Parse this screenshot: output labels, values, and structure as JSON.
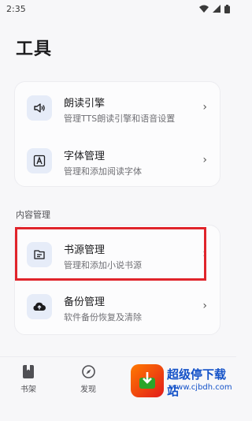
{
  "status_bar": {
    "time": "2:35"
  },
  "page": {
    "title": "工具"
  },
  "group1": {
    "items": [
      {
        "title": "朗读引擎",
        "subtitle": "管理TTS朗读引擎和语音设置",
        "icon": "speaker-icon"
      },
      {
        "title": "字体管理",
        "subtitle": "管理和添加阅读字体",
        "icon": "font-icon"
      }
    ]
  },
  "section": {
    "label": "内容管理"
  },
  "group2": {
    "items": [
      {
        "title": "书源管理",
        "subtitle": "管理和添加小说书源",
        "icon": "document-icon"
      },
      {
        "title": "备份管理",
        "subtitle": "软件备份恢复及清除",
        "icon": "cloud-upload-icon"
      }
    ]
  },
  "bottom_nav": {
    "items": [
      {
        "label": "书架",
        "icon": "book-icon"
      },
      {
        "label": "发现",
        "icon": "compass-icon"
      }
    ]
  },
  "watermark": {
    "text": "超级停下载站",
    "url": "www.cjbdh.com"
  },
  "colors": {
    "highlight": "#e0242b",
    "icon_bg": "#e6ecf8",
    "watermark": "#1452c8"
  }
}
